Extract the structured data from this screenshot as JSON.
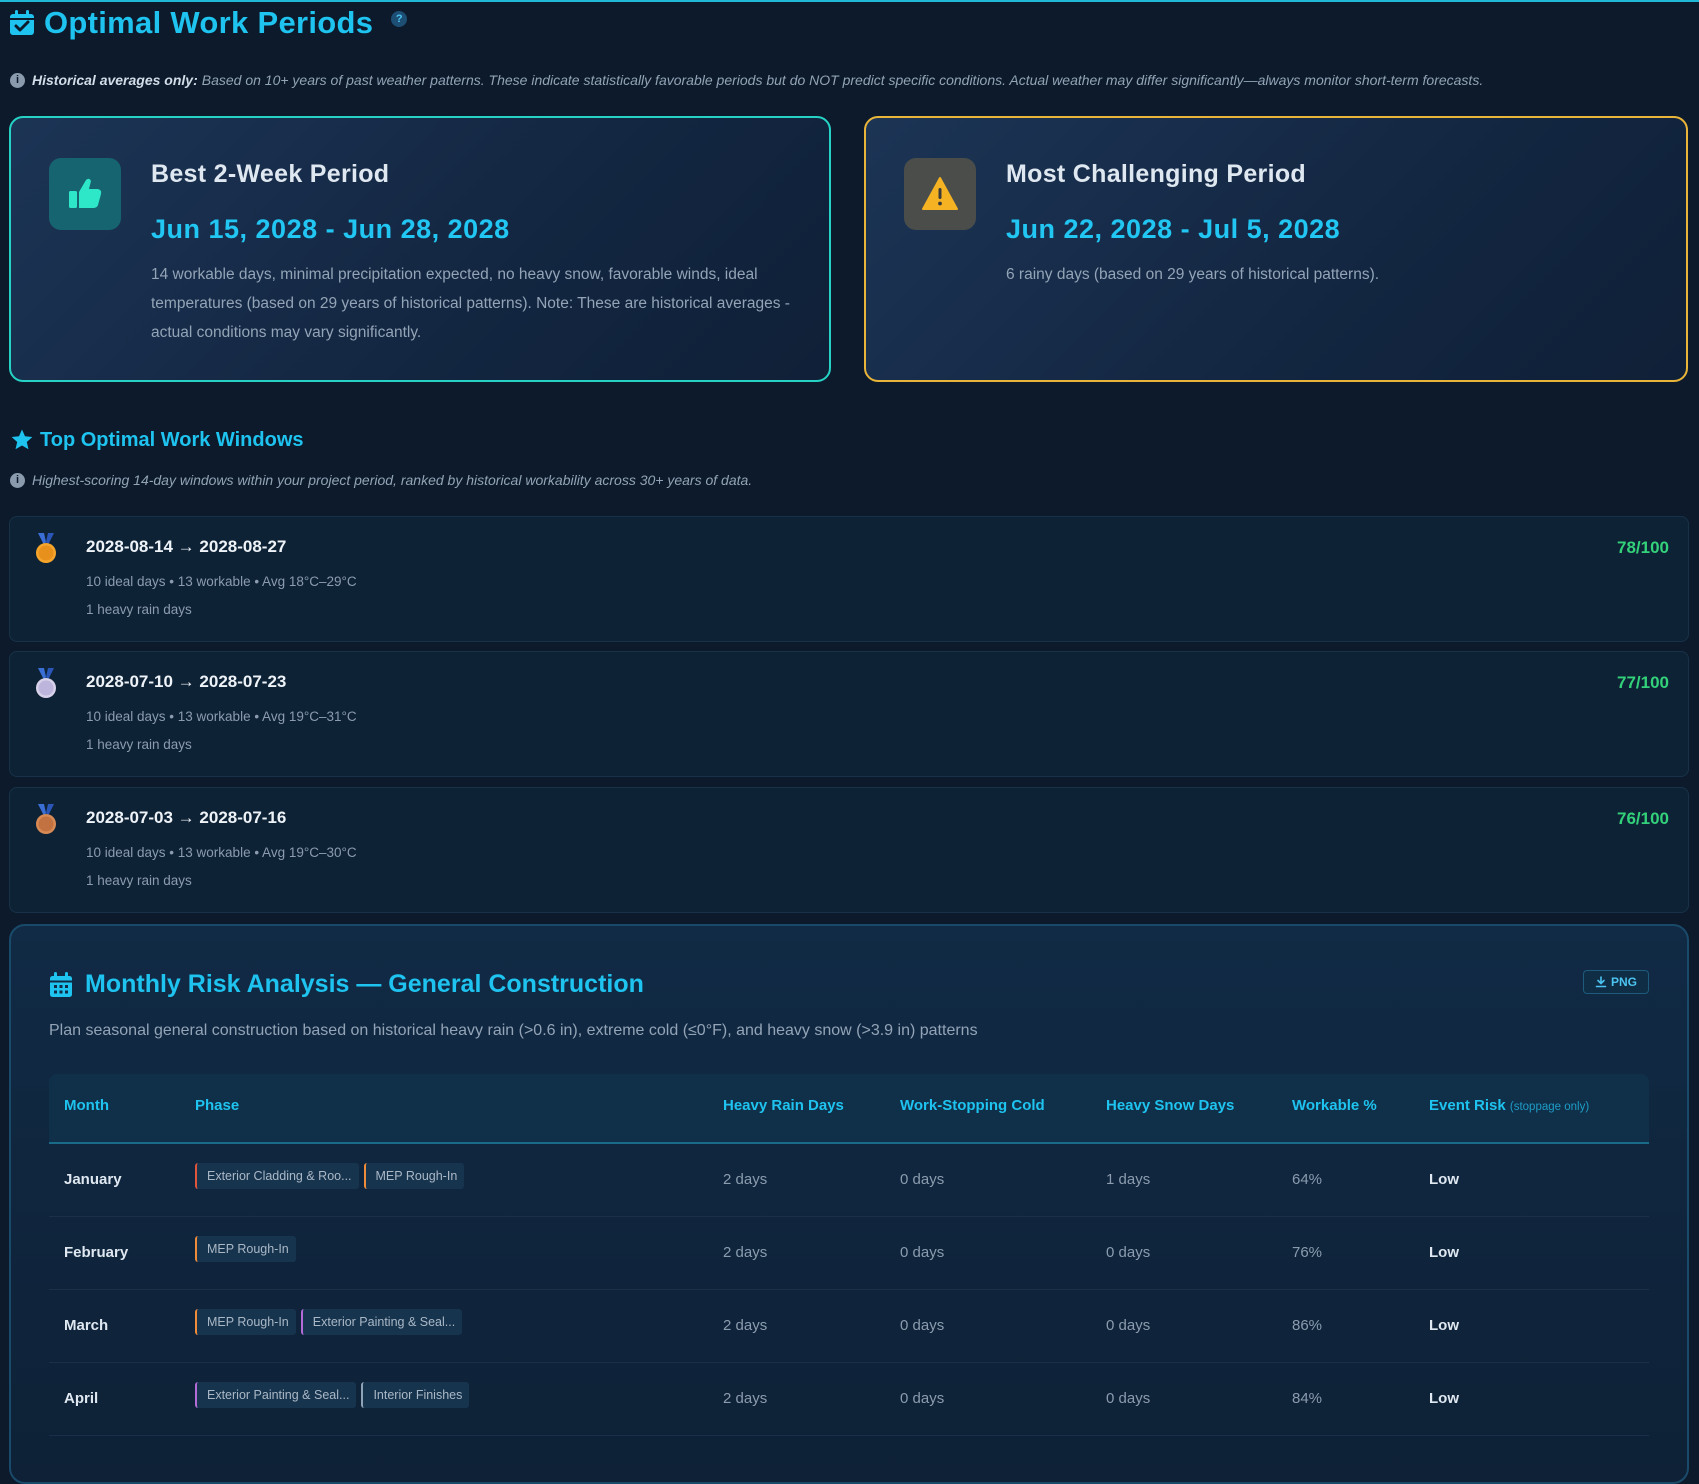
{
  "header": {
    "title": "Optimal Work Periods",
    "help": "?"
  },
  "disclaimer": {
    "bold": "Historical averages only:",
    "text": "Based on 10+ years of past weather patterns. These indicate statistically favorable periods but do NOT predict specific conditions. Actual weather may differ significantly—always monitor short-term forecasts."
  },
  "best": {
    "heading": "Best 2-Week Period",
    "range": "Jun 15, 2028 - Jun 28, 2028",
    "description": "14 workable days, minimal precipitation expected, no heavy snow, favorable winds, ideal temperatures (based on 29 years of historical patterns). Note: These are historical averages - actual conditions may vary significantly."
  },
  "worst": {
    "heading": "Most Challenging Period",
    "range": "Jun 22, 2028 - Jul 5, 2028",
    "description": "6 rainy days (based on 29 years of historical patterns)."
  },
  "windows": {
    "title": "Top Optimal Work Windows",
    "subtitle": "Highest-scoring 14-day windows within your project period, ranked by historical workability across 30+ years of data.",
    "items": [
      {
        "rank": "1",
        "range": "2028-08-14 → 2028-08-27",
        "stats": "10 ideal days • 13 workable • Avg 18°C–29°C",
        "extra": "1 heavy rain days",
        "score": "78/100"
      },
      {
        "rank": "2",
        "range": "2028-07-10 → 2028-07-23",
        "stats": "10 ideal days • 13 workable • Avg 19°C–31°C",
        "extra": "1 heavy rain days",
        "score": "77/100"
      },
      {
        "rank": "3",
        "range": "2028-07-03 → 2028-07-16",
        "stats": "10 ideal days • 13 workable • Avg 19°C–30°C",
        "extra": "1 heavy rain days",
        "score": "76/100"
      }
    ]
  },
  "risk": {
    "title": "Monthly Risk Analysis — General Construction",
    "png_label": "PNG",
    "subtitle": "Plan seasonal general construction based on historical heavy rain (>0.6 in), extreme cold (≤0°F), and heavy snow (>3.9 in) patterns",
    "columns": {
      "month": "Month",
      "phase": "Phase",
      "rain": "Heavy Rain Days",
      "cold": "Work-Stopping Cold",
      "snow": "Heavy Snow Days",
      "workable": "Workable %",
      "event": "Event Risk",
      "event_note": "(stoppage only)"
    },
    "rows": [
      {
        "month": "January",
        "phases": [
          "Exterior Cladding & Roo...",
          "MEP Rough-In"
        ],
        "rain": "2 days",
        "cold": "0 days",
        "snow": "1 days",
        "workable": "64%",
        "risk": "Low"
      },
      {
        "month": "February",
        "phases": [
          "MEP Rough-In"
        ],
        "rain": "2 days",
        "cold": "0 days",
        "snow": "0 days",
        "workable": "76%",
        "risk": "Low"
      },
      {
        "month": "March",
        "phases": [
          "MEP Rough-In",
          "Exterior Painting & Seal..."
        ],
        "rain": "2 days",
        "cold": "0 days",
        "snow": "0 days",
        "workable": "86%",
        "risk": "Low"
      },
      {
        "month": "April",
        "phases": [
          "Exterior Painting & Seal...",
          "Interior Finishes"
        ],
        "rain": "2 days",
        "cold": "0 days",
        "snow": "0 days",
        "workable": "84%",
        "risk": "Low"
      }
    ]
  },
  "colors": {
    "accent": "#1ec3ef",
    "best_border": "#26d2c4",
    "worst_border": "#e8b53a",
    "score": "#33d17a",
    "background": "#0c1a2b"
  }
}
